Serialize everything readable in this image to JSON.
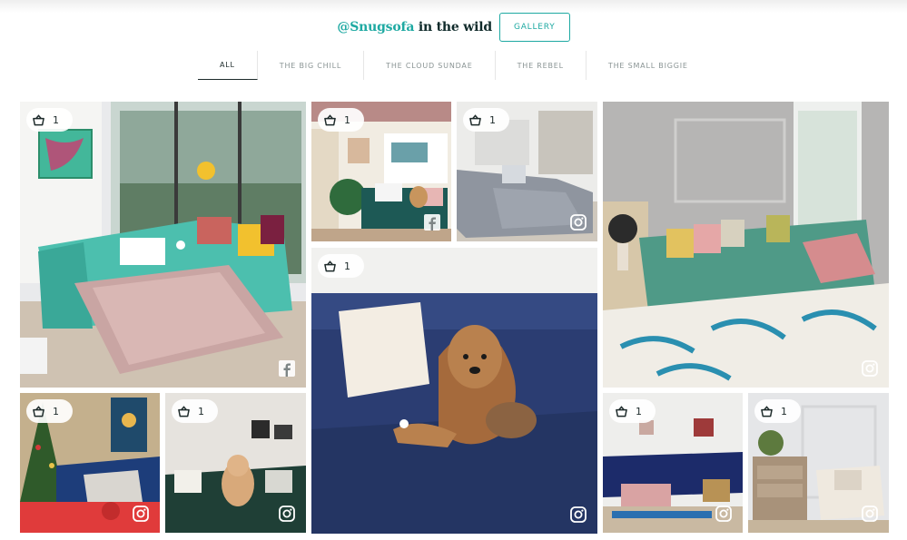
{
  "header": {
    "handle": "@Snugsofa",
    "title_rest": " in the wild",
    "gallery_label": "GALLERY"
  },
  "tabs": [
    "ALL",
    "THE BIG CHILL",
    "THE CLOUD SUNDAE",
    "THE REBEL",
    "THE SMALL BIGGIE"
  ],
  "active_tab": "ALL",
  "colors": {
    "accent": "#1ea9a2",
    "text": "#1d2a2a"
  },
  "tiles": [
    {
      "count": "1",
      "social": "facebook-icon",
      "scene": "teal sofa bed with pink throw in bright living room"
    },
    {
      "count": "1",
      "social": "facebook-icon",
      "scene": "teal sofa with dog beside plant"
    },
    {
      "count": "1",
      "social": "instagram-icon",
      "scene": "grey corner sofa in open plan room"
    },
    {
      "count": "1",
      "social": "instagram-icon",
      "scene": "blue velvet sofa with cockapoo dog"
    },
    {
      "count": "1",
      "social": "instagram-icon",
      "scene": "green corner sofa with colourful rug"
    },
    {
      "count": "1",
      "social": "instagram-icon",
      "scene": "navy sofa with christmas tree"
    },
    {
      "count": "1",
      "social": "instagram-icon",
      "scene": "dark green sofa with poodle"
    },
    {
      "count": "1",
      "social": "instagram-icon",
      "scene": "navy corner sofa with pink footstool"
    },
    {
      "count": "1",
      "social": "instagram-icon",
      "scene": "cream armchair with wooden drawers"
    }
  ]
}
